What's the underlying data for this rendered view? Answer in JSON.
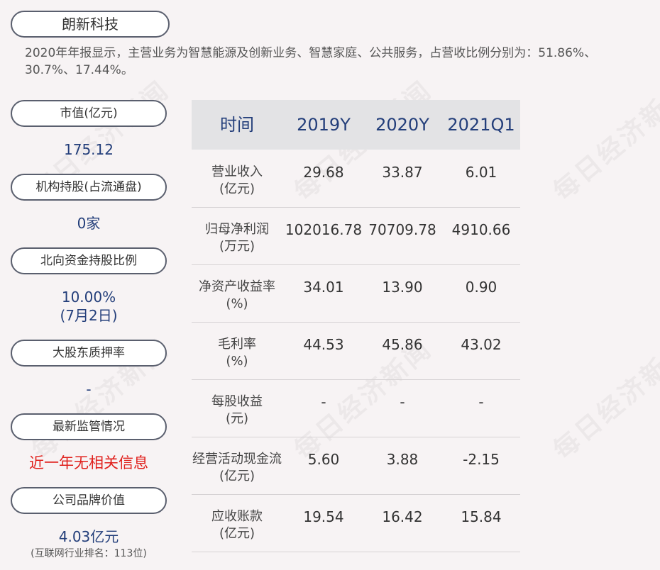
{
  "company_name": "朗新科技",
  "intro": "2020年年报显示，主营业务为智慧能源及创新业务、智慧家庭、公共服务，占营收比例分别为：51.86%、30.7%、17.44%。",
  "sidebar": {
    "market_cap_label": "市值(亿元)",
    "market_cap_value": "175.12",
    "institution_label": "机构持股(占流通盘)",
    "institution_value": "0家",
    "northbound_label": "北向资金持股比例",
    "northbound_value": "10.00%",
    "northbound_date": "(7月2日)",
    "pledge_label": "大股东质押率",
    "pledge_value": "-",
    "regulation_label": "最新监管情况",
    "regulation_value": "近一年无相关信息",
    "brand_label": "公司品牌价值",
    "brand_value": "4.03亿元",
    "brand_note": "(互联网行业排名：113位)"
  },
  "table": {
    "headers": [
      "时间",
      "2019Y",
      "2020Y",
      "2021Q1"
    ],
    "rows": [
      {
        "label1": "营业收入",
        "label2": "(亿元)",
        "v": [
          "29.68",
          "33.87",
          "6.01"
        ]
      },
      {
        "label1": "归母净利润",
        "label2": "(万元)",
        "v": [
          "102016.78",
          "70709.78",
          "4910.66"
        ]
      },
      {
        "label1": "净资产收益率",
        "label2": "(%)",
        "v": [
          "34.01",
          "13.90",
          "0.90"
        ]
      },
      {
        "label1": "毛利率",
        "label2": "(%)",
        "v": [
          "44.53",
          "45.86",
          "43.02"
        ]
      },
      {
        "label1": "每股收益",
        "label2": "(元)",
        "v": [
          "-",
          "-",
          "-"
        ]
      },
      {
        "label1": "经营活动现金流",
        "label2": "(亿元)",
        "v": [
          "5.60",
          "3.88",
          "-2.15"
        ]
      },
      {
        "label1": "应收账款",
        "label2": "(亿元)",
        "v": [
          "19.54",
          "16.42",
          "15.84"
        ]
      }
    ]
  },
  "watermark": "每日经济新闻"
}
